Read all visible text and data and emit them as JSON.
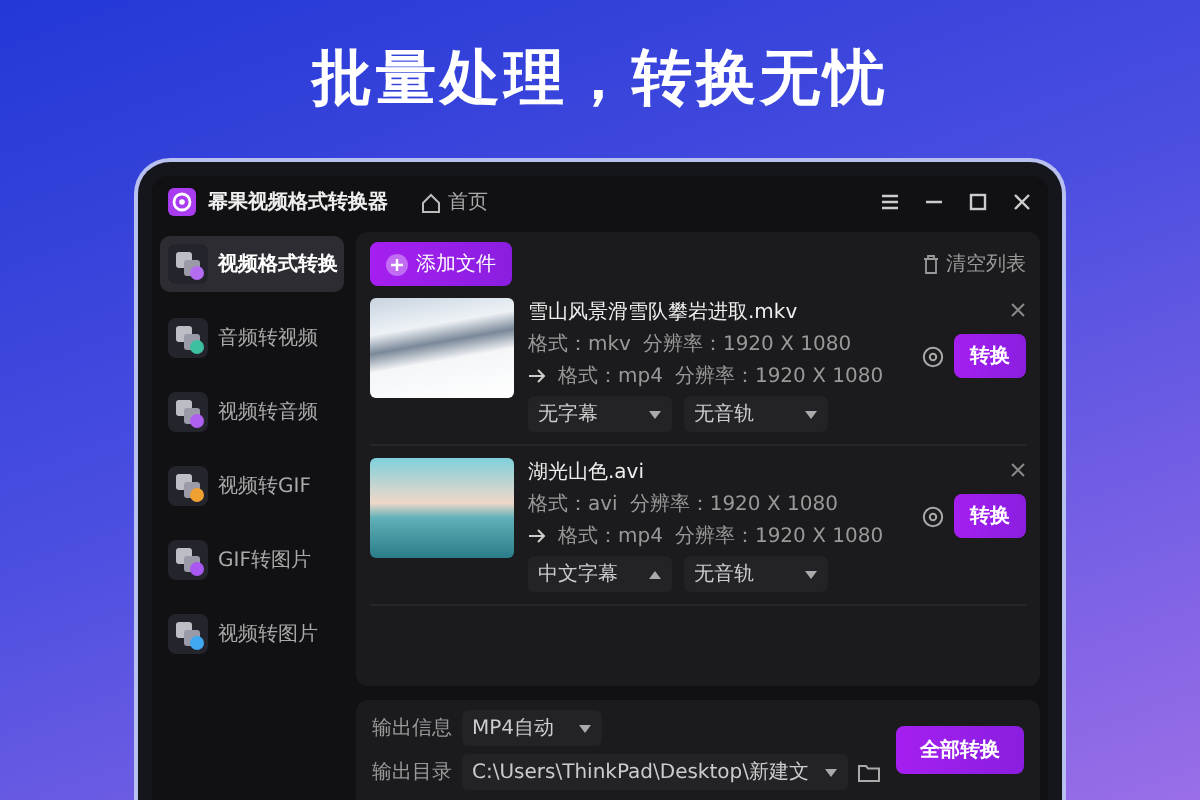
{
  "headline": "批量处理，转换无忧",
  "app": {
    "title": "幂果视频格式转换器",
    "home": "首页"
  },
  "sidebar": {
    "items": [
      {
        "label": "视频格式转换",
        "selected": true,
        "color": "#b46cf0"
      },
      {
        "label": "音频转视频",
        "selected": false,
        "color": "#3cc0a0"
      },
      {
        "label": "视频转音频",
        "selected": false,
        "color": "#b060f0"
      },
      {
        "label": "视频转GIF",
        "selected": false,
        "color": "#f0a030"
      },
      {
        "label": "GIF转图片",
        "selected": false,
        "color": "#a858f0"
      },
      {
        "label": "视频转图片",
        "selected": false,
        "color": "#40a8f0"
      }
    ]
  },
  "toolbar": {
    "add_button": "添加文件",
    "clear_button": "清空列表"
  },
  "files": [
    {
      "name": "雪山风景滑雪队攀岩进取.mkv",
      "kind": "snow",
      "source": [
        "格式：mkv",
        "分辨率：1920 X 1080"
      ],
      "target": [
        "格式：mp4",
        "分辨率：1920 X 1080"
      ],
      "subtitle": {
        "value": "无字幕",
        "expanded": false
      },
      "audio": {
        "value": "无音轨",
        "expanded": false
      },
      "convert_button": "转换"
    },
    {
      "name": "湖光山色.avi",
      "kind": "sea",
      "source": [
        "格式：avi",
        "分辨率：1920 X 1080"
      ],
      "target": [
        "格式：mp4",
        "分辨率：1920 X 1080"
      ],
      "subtitle": {
        "value": "中文字幕",
        "expanded": true
      },
      "audio": {
        "value": "无音轨",
        "expanded": false
      },
      "convert_button": "转换"
    }
  ],
  "output": {
    "format_label": "输出信息",
    "format": "MP4自动",
    "folder_label": "输出目录",
    "folder": "C:\\Users\\ThinkPad\\Desktop\\新建文",
    "convert_all_button": "全部转换"
  }
}
